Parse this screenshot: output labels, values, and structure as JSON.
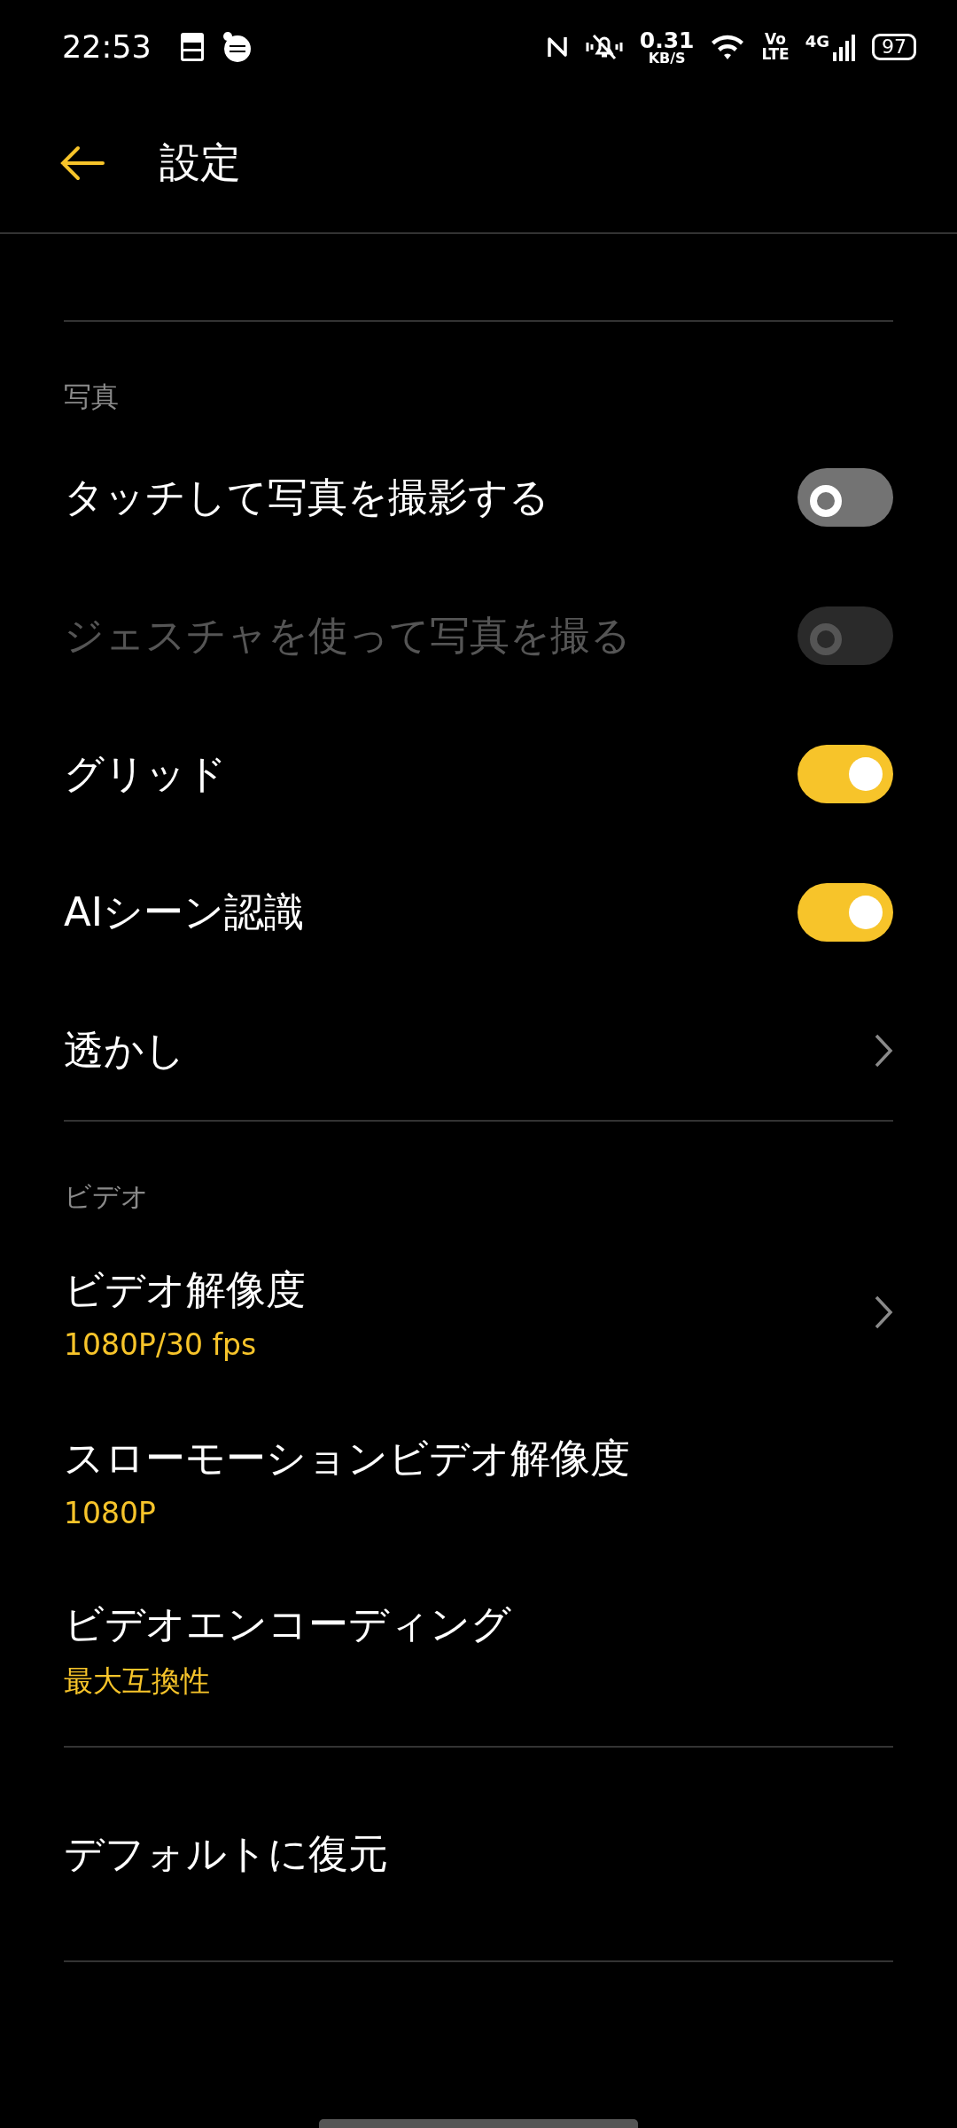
{
  "status_bar": {
    "time": "22:53",
    "speed_value": "0.31",
    "speed_unit": "KB/S",
    "volte_top": "Vo",
    "volte_bottom": "LTE",
    "network": "4G",
    "battery": "97"
  },
  "header": {
    "title": "設定"
  },
  "sections": [
    {
      "title": "写真",
      "items": [
        {
          "kind": "toggle",
          "label": "タッチして写真を撮影する",
          "on": false,
          "disabled": false
        },
        {
          "kind": "toggle",
          "label": "ジェスチャを使って写真を撮る",
          "on": false,
          "disabled": true
        },
        {
          "kind": "toggle",
          "label": "グリッド",
          "on": true,
          "disabled": false
        },
        {
          "kind": "toggle",
          "label": "AIシーン認識",
          "on": true,
          "disabled": false
        },
        {
          "kind": "link",
          "label": "透かし"
        }
      ]
    },
    {
      "title": "ビデオ",
      "items": [
        {
          "kind": "link",
          "label": "ビデオ解像度",
          "value": "1080P/30 fps"
        },
        {
          "kind": "value",
          "label": "スローモーションビデオ解像度",
          "value": "1080P"
        },
        {
          "kind": "value",
          "label": "ビデオエンコーディング",
          "value": "最大互換性"
        }
      ]
    }
  ],
  "reset": {
    "label": "デフォルトに復元"
  }
}
